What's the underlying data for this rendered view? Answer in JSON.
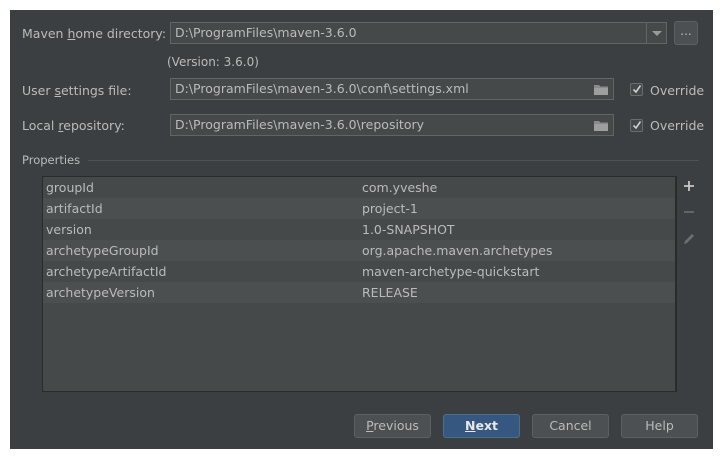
{
  "maven_home": {
    "label": "Maven home directory:",
    "mnemonic": "h",
    "label_pre": "Maven ",
    "label_mn": "h",
    "label_post": "ome directory:",
    "value": "D:\\ProgramFiles\\maven-3.6.0",
    "version_note": "(Version: 3.6.0)",
    "browse_label": "..."
  },
  "user_settings": {
    "label_pre": "User ",
    "label_mn": "s",
    "label_post": "ettings file:",
    "value": "D:\\ProgramFiles\\maven-3.6.0\\conf\\settings.xml",
    "override_label": "Override",
    "override_checked": true
  },
  "local_repo": {
    "label_pre": "Local ",
    "label_mn": "r",
    "label_post": "epository:",
    "value": "D:\\ProgramFiles\\maven-3.6.0\\repository",
    "override_label": "Override",
    "override_checked": true
  },
  "properties": {
    "title": "Properties",
    "rows": [
      {
        "key": "groupId",
        "value": "com.yveshe"
      },
      {
        "key": "artifactId",
        "value": "project-1"
      },
      {
        "key": "version",
        "value": "1.0-SNAPSHOT"
      },
      {
        "key": "archetypeGroupId",
        "value": "org.apache.maven.archetypes"
      },
      {
        "key": "archetypeArtifactId",
        "value": "maven-archetype-quickstart"
      },
      {
        "key": "archetypeVersion",
        "value": "RELEASE"
      }
    ],
    "toolbar": [
      "plus-icon",
      "minus-icon",
      "edit-icon"
    ]
  },
  "buttons": {
    "previous_mn": "P",
    "previous_rest": "revious",
    "next_mn": "N",
    "next_rest": "ext",
    "cancel": "Cancel",
    "help": "Help"
  },
  "colors": {
    "background": "#3c3f41",
    "field": "#45494a",
    "primary_button": "#365880",
    "text": "#bbbbbb"
  }
}
